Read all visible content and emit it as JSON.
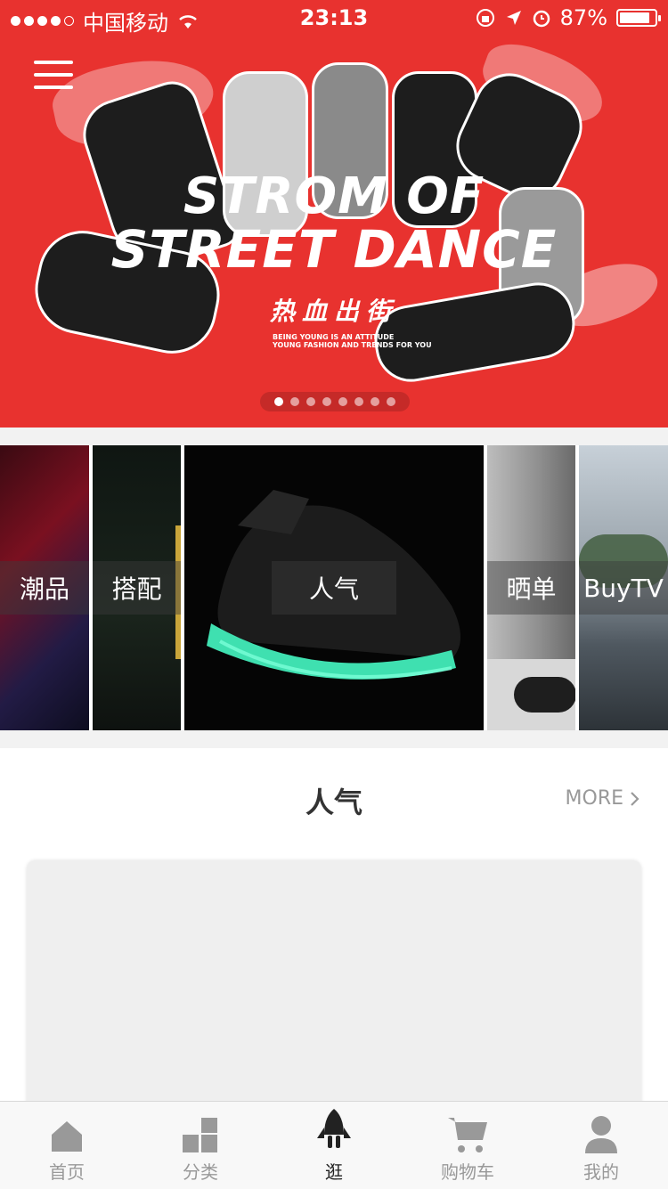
{
  "status_bar": {
    "carrier": "中国移动",
    "time": "23:13",
    "battery": "87%",
    "battery_level": 0.87
  },
  "banner": {
    "headline_line1": "STROM OF",
    "headline_line2": "STREET DANCE",
    "chinese_title": "热血出街",
    "tagline_line1": "BEING YOUNG IS AN ATTITUDE",
    "tagline_line2": "YOUNG FASHION AND TRENDS FOR YOU",
    "page_count": 8,
    "active_page": 1
  },
  "categories": [
    {
      "label": "潮品"
    },
    {
      "label": "搭配"
    },
    {
      "label": "人气"
    },
    {
      "label": "晒单"
    },
    {
      "label": "BuyTV"
    }
  ],
  "section": {
    "title": "人气",
    "more_label": "MORE"
  },
  "tabbar": {
    "items": [
      {
        "label": "首页",
        "icon": "home-icon"
      },
      {
        "label": "分类",
        "icon": "category-icon"
      },
      {
        "label": "逛",
        "icon": "rocket-icon",
        "active": true
      },
      {
        "label": "购物车",
        "icon": "cart-icon"
      },
      {
        "label": "我的",
        "icon": "user-icon"
      }
    ]
  },
  "colors": {
    "banner_red": "#e8322f",
    "tab_inactive": "#999999",
    "tab_active": "#222222"
  }
}
